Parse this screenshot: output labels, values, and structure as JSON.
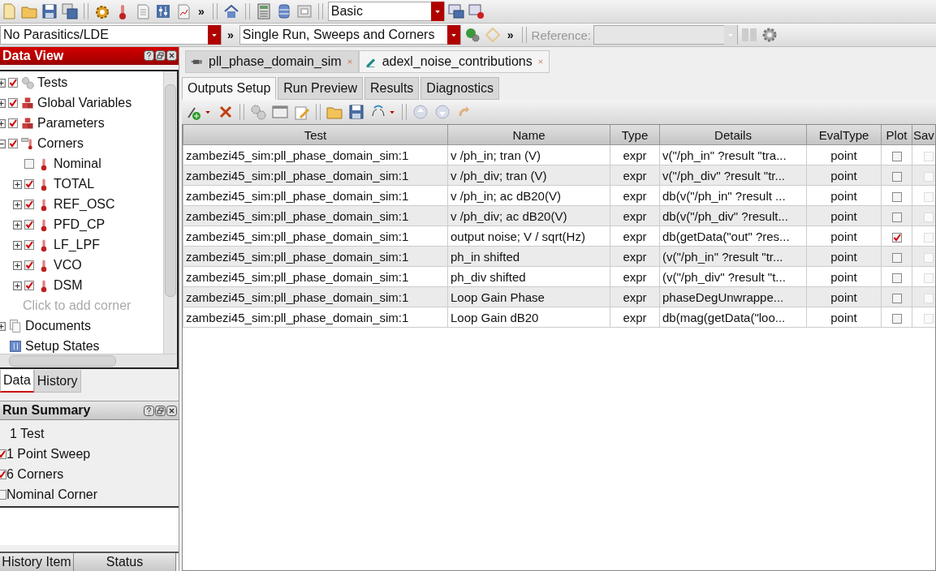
{
  "toolbar_1": {
    "overflow": "»",
    "mode": "Basic"
  },
  "toolbar_2": {
    "parasitics": "No Parasitics/LDE",
    "overflow_1": "»",
    "run_mode": "Single Run, Sweeps and Corners",
    "overflow_2": "»",
    "reference": {
      "label": "Reference:",
      "disabled": true
    }
  },
  "data_view": {
    "title": "Data View",
    "tree": [
      {
        "label": "Tests",
        "kind": "gear",
        "checked": true,
        "expanded": false
      },
      {
        "label": "Global Variables",
        "kind": "cubes",
        "checked": true,
        "expanded": false
      },
      {
        "label": "Parameters",
        "kind": "cubes",
        "checked": true,
        "expanded": false
      },
      {
        "label": "Corners",
        "kind": "corners",
        "checked": true,
        "expanded": true,
        "children": [
          {
            "label": "Nominal",
            "kind": "thermo",
            "checked": false
          },
          {
            "label": "TOTAL",
            "kind": "thermo",
            "checked": true,
            "expanded": false
          },
          {
            "label": "REF_OSC",
            "kind": "thermo",
            "checked": true,
            "expanded": false
          },
          {
            "label": "PFD_CP",
            "kind": "thermo",
            "checked": true,
            "expanded": false
          },
          {
            "label": "LF_LPF",
            "kind": "thermo",
            "checked": true,
            "expanded": false
          },
          {
            "label": "VCO",
            "kind": "thermo",
            "checked": true,
            "expanded": false
          },
          {
            "label": "DSM",
            "kind": "thermo",
            "checked": true,
            "expanded": false
          },
          {
            "label": "Click to add corner",
            "kind": "placeholder"
          }
        ]
      },
      {
        "label": "Documents",
        "kind": "documents",
        "expanded": false
      },
      {
        "label": "Setup States",
        "kind": "states"
      }
    ],
    "tabs": [
      {
        "label": "Data",
        "selected": true
      },
      {
        "label": "History",
        "selected": false
      }
    ]
  },
  "run_summary": {
    "title": "Run Summary",
    "items": [
      {
        "text": "1 Test",
        "kind": "plain"
      },
      {
        "text": "1 Point Sweep",
        "kind": "check",
        "checked": true
      },
      {
        "text": "6 Corners",
        "kind": "check",
        "checked": true
      },
      {
        "text": "Nominal Corner",
        "kind": "check",
        "checked": false
      }
    ],
    "history_columns": [
      "History Item",
      "Status"
    ]
  },
  "document_tabs": [
    {
      "label": "pll_phase_domain_sim",
      "kind": "plug",
      "selected": false
    },
    {
      "label": "adexl_noise_contributions",
      "kind": "pen",
      "selected": true
    }
  ],
  "view_tabs": [
    {
      "label": "Outputs Setup",
      "selected": true
    },
    {
      "label": "Run Preview",
      "selected": false
    },
    {
      "label": "Results",
      "selected": false
    },
    {
      "label": "Diagnostics",
      "selected": false
    }
  ],
  "outputs_table": {
    "columns": [
      "Test",
      "Name",
      "Type",
      "Details",
      "EvalType",
      "Plot",
      "Sav"
    ],
    "rows": [
      {
        "test": "zambezi45_sim:pll_phase_domain_sim:1",
        "name": "v /ph_in; tran (V)",
        "type": "expr",
        "details": "v(\"/ph_in\" ?result \"tra...",
        "eval_type": "point",
        "plot": false,
        "save": false
      },
      {
        "test": "zambezi45_sim:pll_phase_domain_sim:1",
        "name": "v /ph_div; tran (V)",
        "type": "expr",
        "details": "v(\"/ph_div\" ?result \"tr...",
        "eval_type": "point",
        "plot": false,
        "save": false
      },
      {
        "test": "zambezi45_sim:pll_phase_domain_sim:1",
        "name": "v /ph_in; ac dB20(V)",
        "type": "expr",
        "details": "db(v(\"/ph_in\" ?result ...",
        "eval_type": "point",
        "plot": false,
        "save": false
      },
      {
        "test": "zambezi45_sim:pll_phase_domain_sim:1",
        "name": "v /ph_div; ac dB20(V)",
        "type": "expr",
        "details": "db(v(\"/ph_div\" ?result...",
        "eval_type": "point",
        "plot": false,
        "save": false
      },
      {
        "test": "zambezi45_sim:pll_phase_domain_sim:1",
        "name": "output noise; V / sqrt(Hz)",
        "type": "expr",
        "details": "db(getData(\"out\" ?res...",
        "eval_type": "point",
        "plot": true,
        "save": false
      },
      {
        "test": "zambezi45_sim:pll_phase_domain_sim:1",
        "name": "ph_in shifted",
        "type": "expr",
        "details": "(v(\"/ph_in\" ?result \"tr...",
        "eval_type": "point",
        "plot": false,
        "save": false
      },
      {
        "test": "zambezi45_sim:pll_phase_domain_sim:1",
        "name": "ph_div shifted",
        "type": "expr",
        "details": "(v(\"/ph_div\" ?result \"t...",
        "eval_type": "point",
        "plot": false,
        "save": false
      },
      {
        "test": "zambezi45_sim:pll_phase_domain_sim:1",
        "name": "Loop Gain Phase",
        "type": "expr",
        "details": "phaseDegUnwrappe...",
        "eval_type": "point",
        "plot": false,
        "save": false
      },
      {
        "test": "zambezi45_sim:pll_phase_domain_sim:1",
        "name": "Loop Gain dB20",
        "type": "expr",
        "details": "db(mag(getData(\"loo...",
        "eval_type": "point",
        "plot": false,
        "save": false
      }
    ]
  }
}
